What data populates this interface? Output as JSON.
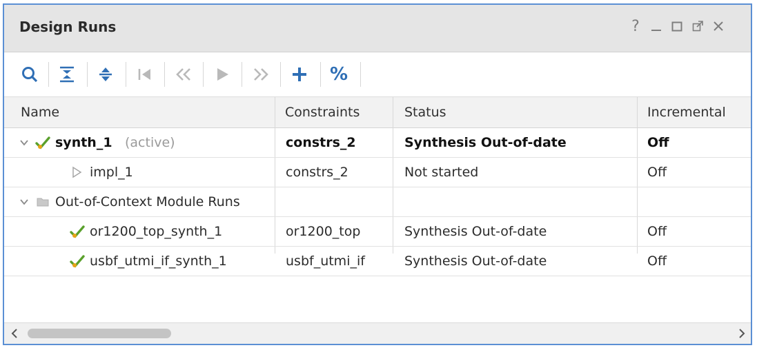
{
  "panel": {
    "title": "Design Runs",
    "window_controls": [
      "help-icon",
      "minimize-icon",
      "maximize-icon",
      "float-icon",
      "close-icon"
    ],
    "help_label": "?"
  },
  "toolbar": {
    "buttons": [
      "search-icon",
      "collapse-all-icon",
      "expand-all-icon",
      "first-icon",
      "previous-icon",
      "run-icon",
      "next-icon",
      "add-icon",
      "percent-icon"
    ],
    "percent_label": "%"
  },
  "table": {
    "columns": [
      "Name",
      "Constraints",
      "Status",
      "Incremental"
    ],
    "rows": [
      {
        "kind": "run",
        "expanded": true,
        "name": "synth_1",
        "suffix": "(active)",
        "constraints": "constrs_2",
        "status": "Synthesis Out-of-date",
        "incremental": "Off",
        "bold": true,
        "status_icon": "checkmark-icon"
      },
      {
        "kind": "child",
        "name": "impl_1",
        "constraints": "constrs_2",
        "status": "Not started",
        "incremental": "Off",
        "status_icon": "play-outline-icon"
      },
      {
        "kind": "group",
        "expanded": true,
        "name": "Out-of-Context Module Runs",
        "status_icon": "folder-icon"
      },
      {
        "kind": "child",
        "name": "or1200_top_synth_1",
        "constraints": "or1200_top",
        "status": "Synthesis Out-of-date",
        "incremental": "Off",
        "status_icon": "checkmark-icon"
      },
      {
        "kind": "child",
        "name": "usbf_utmi_if_synth_1",
        "constraints": "usbf_utmi_if",
        "status": "Synthesis Out-of-date",
        "incremental": "Off",
        "status_icon": "checkmark-icon"
      }
    ]
  },
  "colors": {
    "panel_border": "#5b8fd4",
    "check_green": "#5aa02c",
    "check_orange": "#e8a317",
    "toolbar_icon": "#2f6fb5"
  }
}
